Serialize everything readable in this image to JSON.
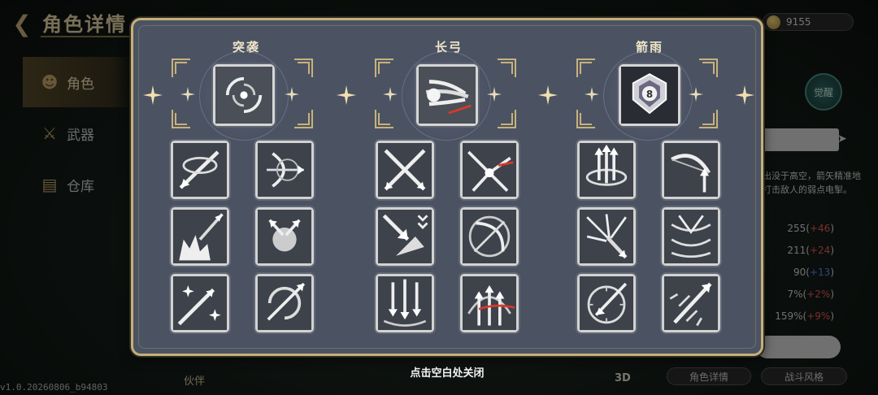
{
  "header": {
    "title": "角色详情",
    "coins": "9155"
  },
  "nav": {
    "items": [
      {
        "label": "角色"
      },
      {
        "label": "武器"
      },
      {
        "label": "仓库"
      }
    ]
  },
  "right_panel": {
    "badge": "觉醒",
    "tab_label": "",
    "description": "出没于高空，箭矢精准地打击敌人的弱点电掣。",
    "stats": [
      {
        "base": "255",
        "delta": "+46",
        "sign": "plus"
      },
      {
        "base": "211",
        "delta": "+24",
        "sign": "plus"
      },
      {
        "base": "90",
        "delta": "+13",
        "sign": "minus"
      },
      {
        "base": "7%",
        "delta": "+2%",
        "sign": "plus"
      },
      {
        "base": "159%",
        "delta": "+9%",
        "sign": "plus"
      }
    ]
  },
  "bottom": {
    "partner_label": "伙伴",
    "threed_label": "3D",
    "char_detail_button": "角色详情",
    "battle_style_button": "战斗风格",
    "version": "v1.0.20260806_b94803"
  },
  "modal": {
    "columns": [
      {
        "title": "突袭",
        "main_icon": "vortex-arrows-icon",
        "skills": [
          "crossbow-slash-icon",
          "ricochet-bow-icon",
          "explosive-arrow-icon",
          "split-arrows-icon",
          "sparkle-arrow-icon",
          "spiral-arrow-icon"
        ]
      },
      {
        "title": "长弓",
        "main_icon": "wind-burst-icon",
        "skills": [
          "cross-arrows-icon",
          "burst-arrow-icon",
          "arrow-impact-icon",
          "bow-target-icon",
          "arrow-rain-icon",
          "arc-volley-icon"
        ]
      },
      {
        "title": "箭雨",
        "main_icon": "shield-8-icon",
        "skills": [
          "multi-arrow-ring-icon",
          "upward-bow-icon",
          "scatter-arrows-icon",
          "feather-storm-icon",
          "dial-arrow-icon",
          "spread-shot-icon"
        ]
      }
    ],
    "close_hint": "点击空白处关闭"
  },
  "colors": {
    "modal_bg": "#4b5363",
    "modal_border": "#c6b079",
    "accent_gold": "#e6d39a"
  }
}
